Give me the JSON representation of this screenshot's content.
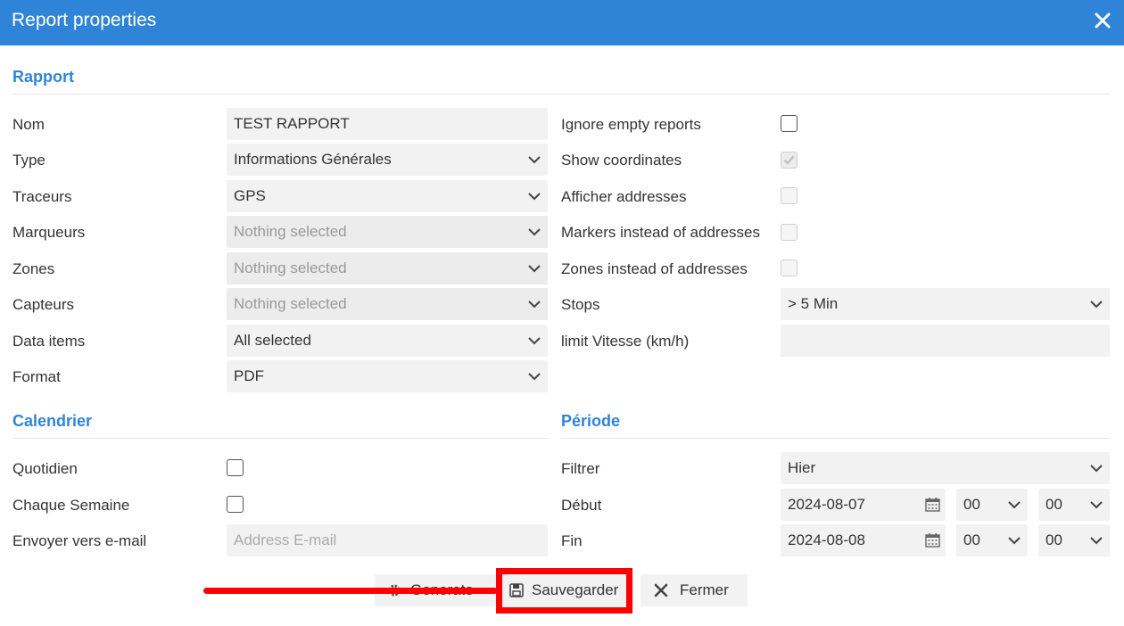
{
  "dialog": {
    "title": "Report properties"
  },
  "sections": {
    "rapport": "Rapport",
    "calendrier": "Calendrier",
    "periode": "Période"
  },
  "left_fields": {
    "nom": {
      "label": "Nom",
      "value": "TEST RAPPORT"
    },
    "type": {
      "label": "Type",
      "value": "Informations Générales"
    },
    "traceurs": {
      "label": "Traceurs",
      "value": "GPS"
    },
    "marqueurs": {
      "label": "Marqueurs",
      "value": "Nothing selected"
    },
    "zones": {
      "label": "Zones",
      "value": "Nothing selected"
    },
    "capteurs": {
      "label": "Capteurs",
      "value": "Nothing selected"
    },
    "data_items": {
      "label": "Data items",
      "value": "All selected"
    },
    "format": {
      "label": "Format",
      "value": "PDF"
    }
  },
  "right_fields": {
    "ignore_empty": {
      "label": "Ignore empty reports",
      "checked": false
    },
    "show_coordinates": {
      "label": "Show coordinates",
      "checked": true,
      "disabled": true
    },
    "afficher_addresses": {
      "label": "Afficher addresses",
      "checked": false,
      "disabled": true
    },
    "markers_instead": {
      "label": "Markers instead of addresses",
      "checked": false,
      "disabled": true
    },
    "zones_instead": {
      "label": "Zones instead of addresses",
      "checked": false,
      "disabled": true
    },
    "stops": {
      "label": "Stops",
      "value": "> 5 Min"
    },
    "limit_vitesse": {
      "label": "limit Vitesse (km/h)",
      "value": ""
    }
  },
  "calendrier": {
    "quotidien": {
      "label": "Quotidien",
      "checked": false
    },
    "chaque_semaine": {
      "label": "Chaque Semaine",
      "checked": false
    },
    "email": {
      "label": "Envoyer vers e-mail",
      "placeholder": "Address E-mail",
      "value": ""
    }
  },
  "periode": {
    "filtrer": {
      "label": "Filtrer",
      "value": "Hier"
    },
    "debut": {
      "label": "Début",
      "date": "2024-08-07",
      "hour": "00",
      "minute": "00"
    },
    "fin": {
      "label": "Fin",
      "date": "2024-08-08",
      "hour": "00",
      "minute": "00"
    }
  },
  "buttons": {
    "generate": "Generate",
    "save": "Sauvegarder",
    "close": "Fermer"
  },
  "icons": {
    "close": "close-icon",
    "chevron": "chevron-down-icon",
    "calendar": "calendar-icon",
    "save": "floppy-disk-icon",
    "gear": "gear-icon",
    "x": "x-icon"
  },
  "colors": {
    "header": "#2f84d8",
    "section_title": "#2f84d8",
    "field_bg": "#f2f2f2",
    "annotation": "#ff0000"
  }
}
